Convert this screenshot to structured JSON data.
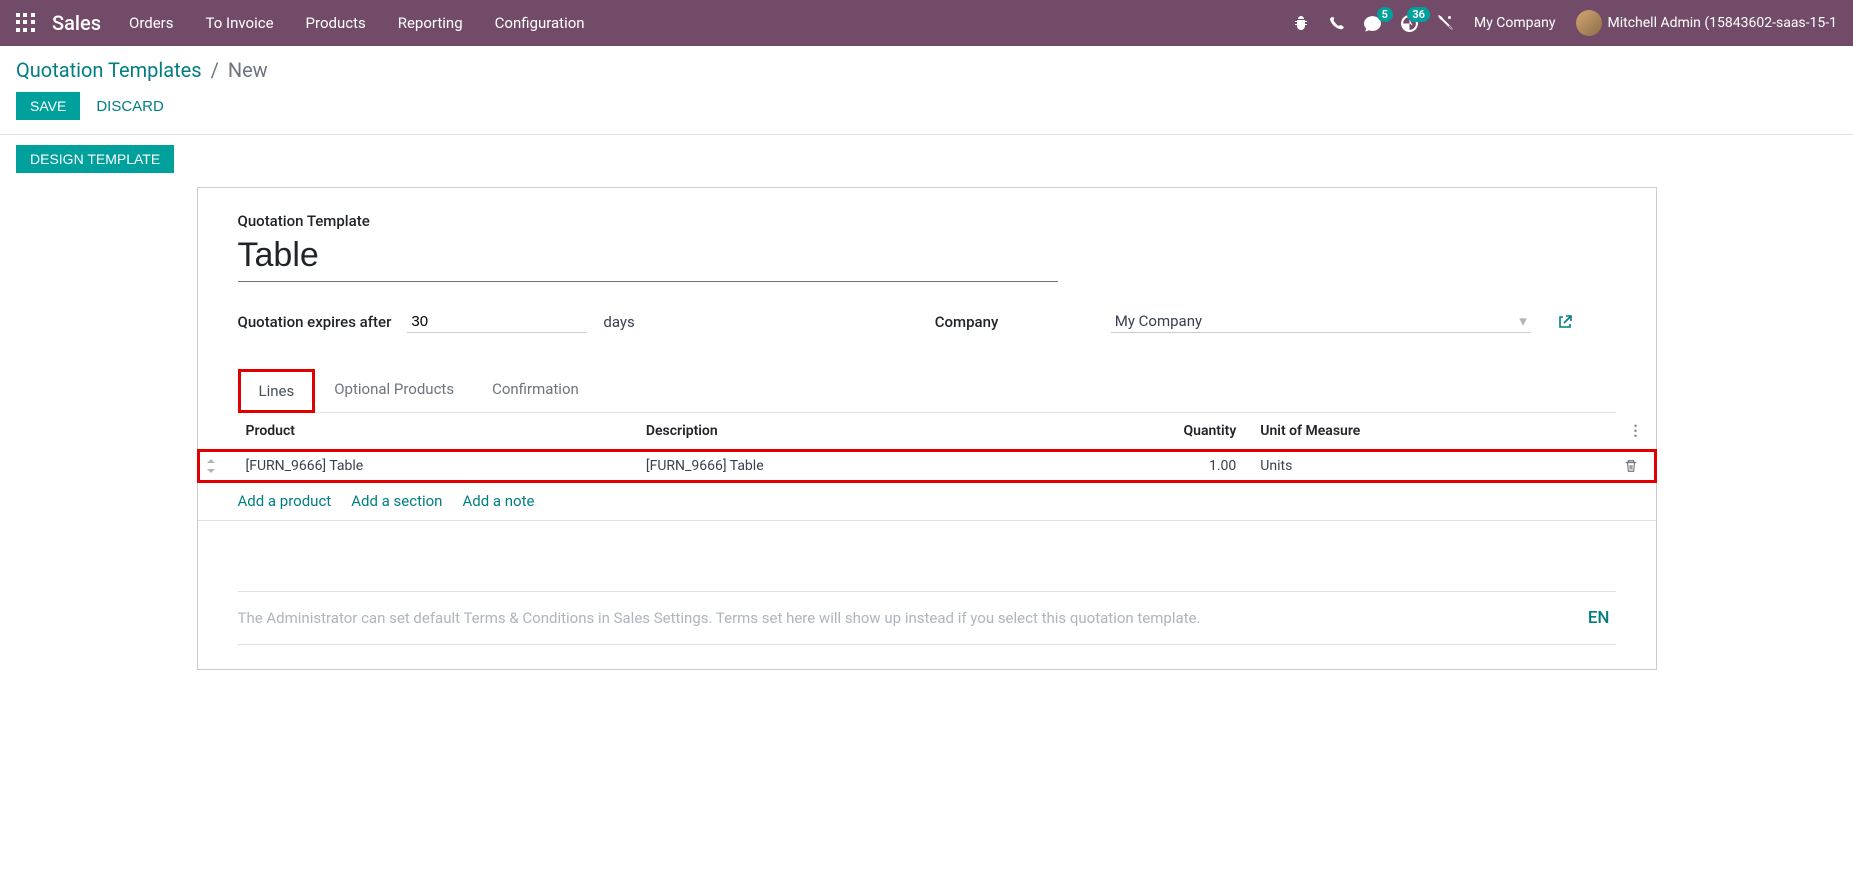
{
  "nav": {
    "brand": "Sales",
    "menu": [
      "Orders",
      "To Invoice",
      "Products",
      "Reporting",
      "Configuration"
    ],
    "msg_badge": "5",
    "activity_badge": "36",
    "company": "My Company",
    "user": "Mitchell Admin (15843602-saas-15-1"
  },
  "breadcrumb": {
    "parent": "Quotation Templates",
    "current": "New"
  },
  "buttons": {
    "save": "SAVE",
    "discard": "DISCARD",
    "design": "DESIGN TEMPLATE"
  },
  "form": {
    "title_label": "Quotation Template",
    "title_value": "Table",
    "expires_label": "Quotation expires after",
    "expires_value": "30",
    "expires_suffix": "days",
    "company_label": "Company",
    "company_value": "My Company"
  },
  "tabs": [
    "Lines",
    "Optional Products",
    "Confirmation"
  ],
  "table": {
    "headers": {
      "product": "Product",
      "description": "Description",
      "quantity": "Quantity",
      "uom": "Unit of Measure"
    },
    "row": {
      "product": "[FURN_9666] Table",
      "description": "[FURN_9666] Table",
      "quantity": "1.00",
      "uom": "Units"
    },
    "add_product": "Add a product",
    "add_section": "Add a section",
    "add_note": "Add a note"
  },
  "terms": {
    "placeholder": "The Administrator can set default Terms & Conditions in Sales Settings. Terms set here will show up instead if you select this quotation template.",
    "lang": "EN"
  }
}
